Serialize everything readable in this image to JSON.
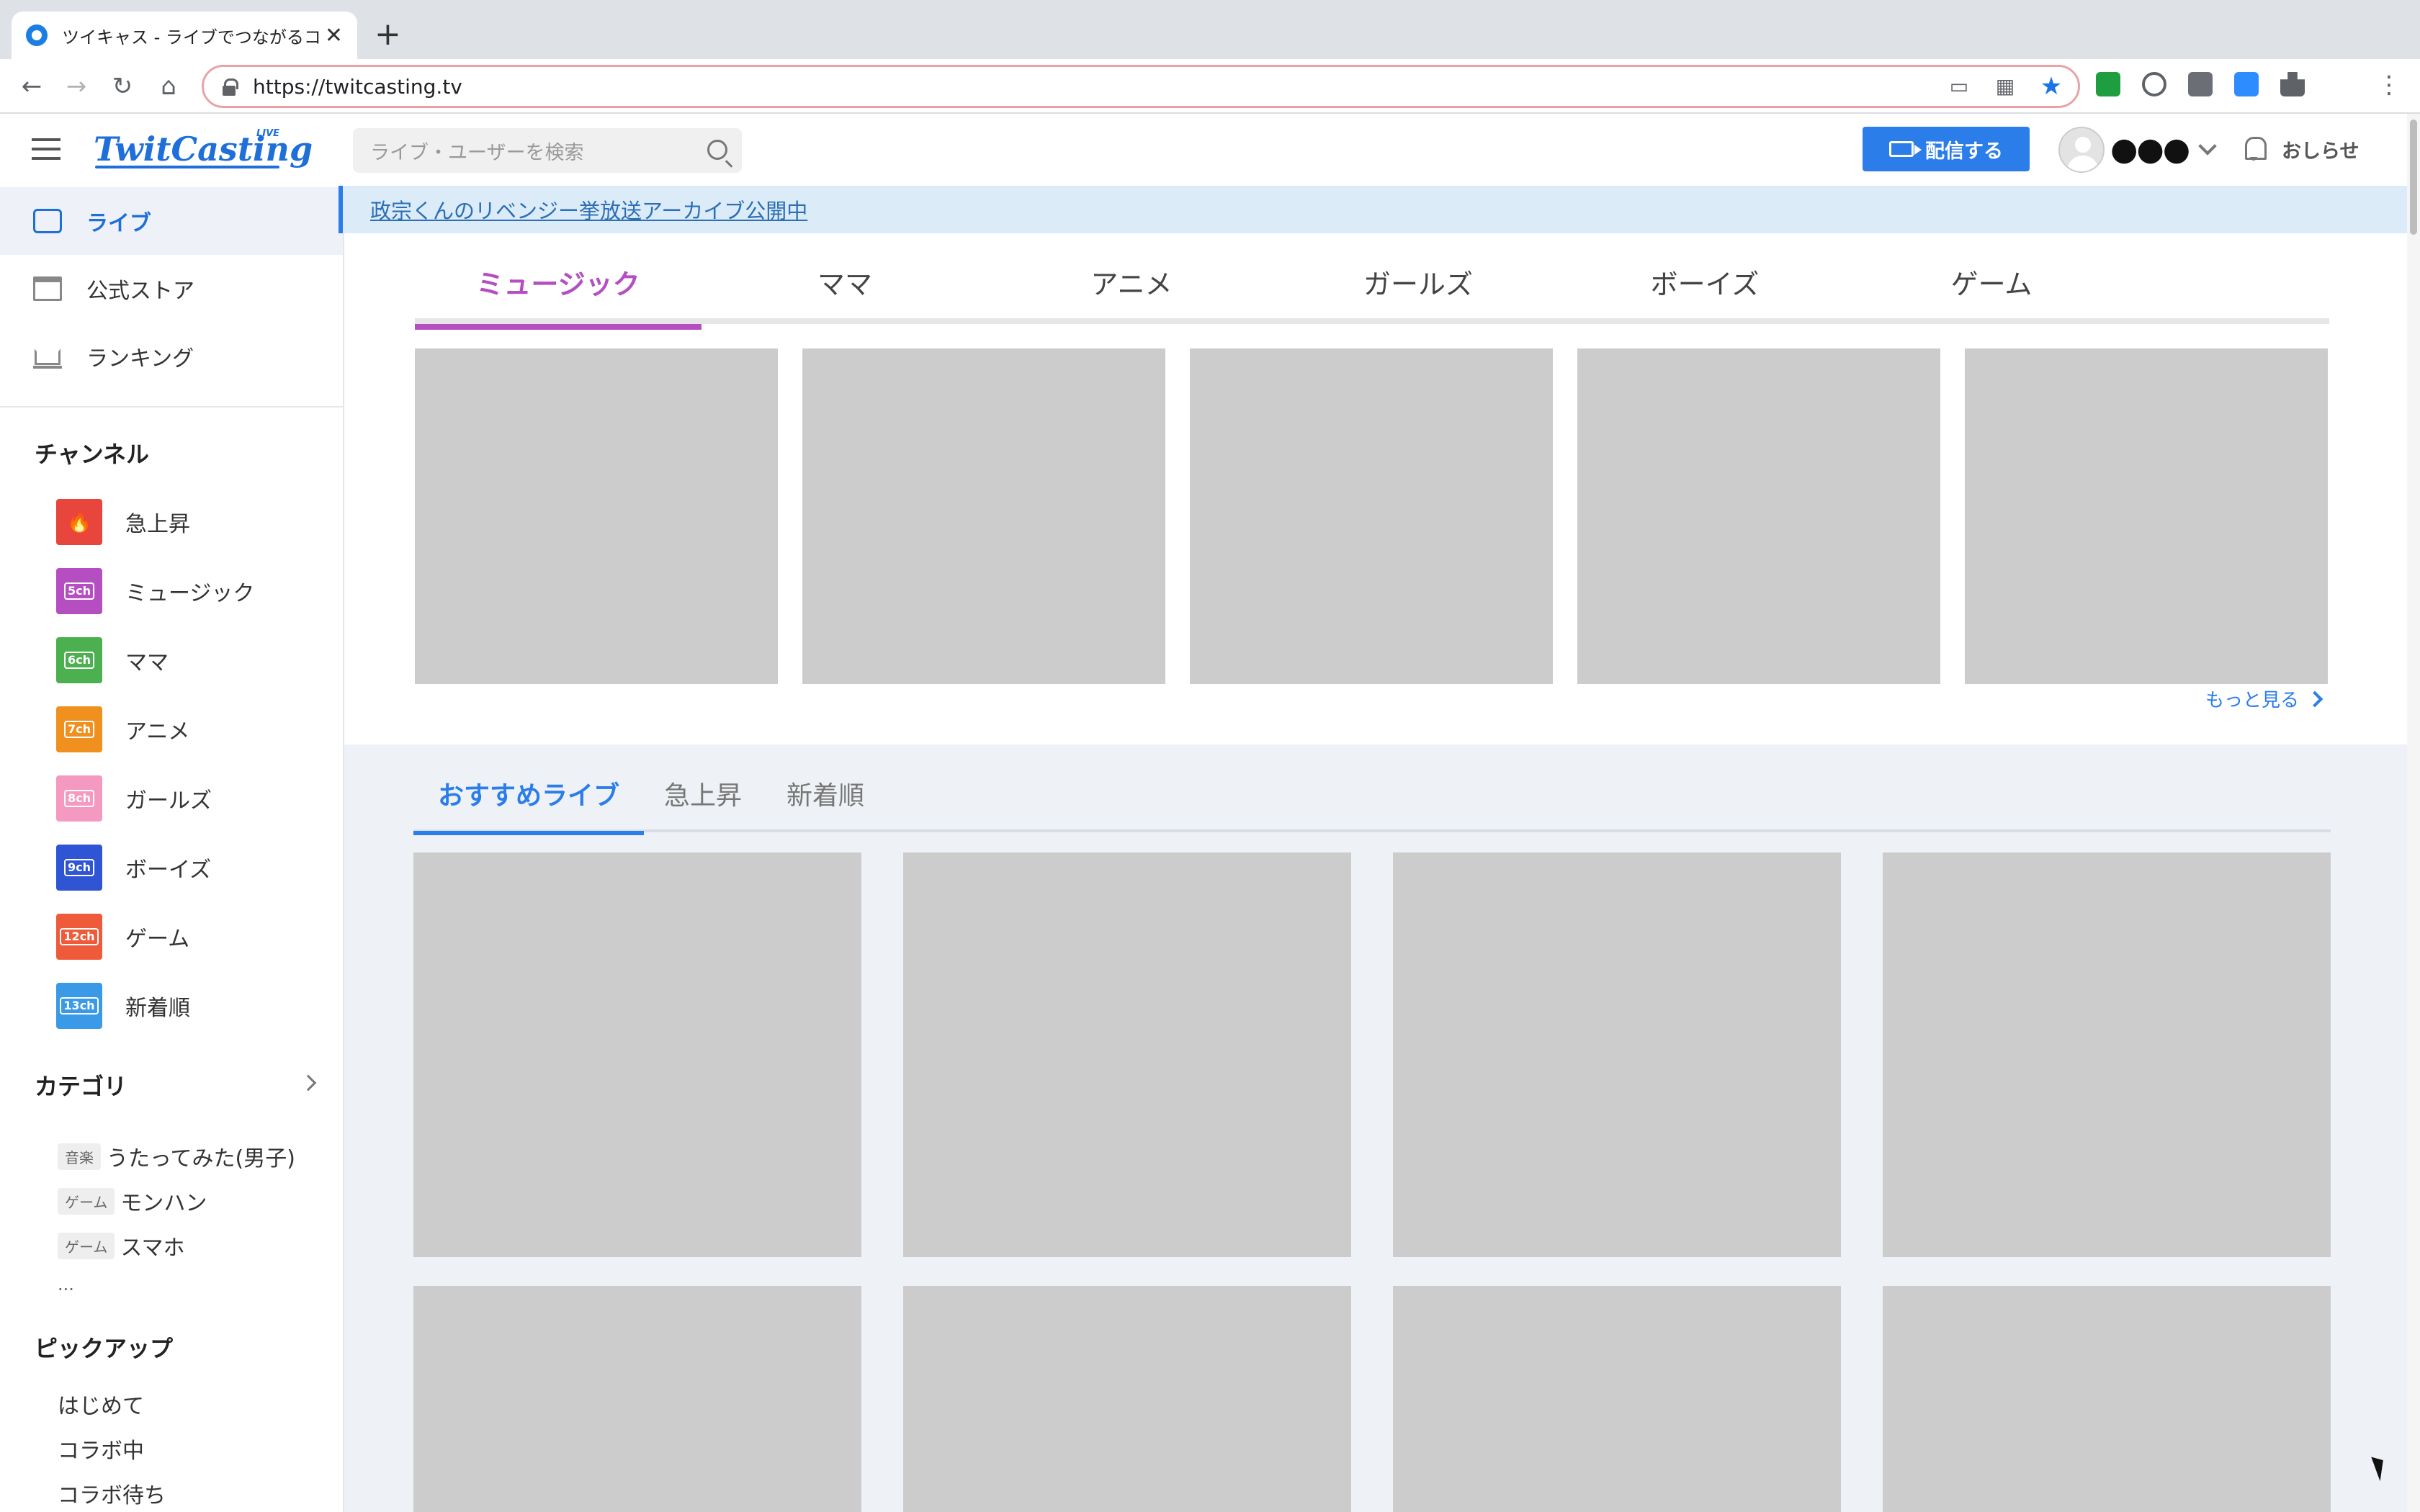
{
  "browser": {
    "tab_title": "ツイキャス - ライブでつながるコミュニティ",
    "tab_close": "✕",
    "new_tab": "+",
    "url": "https://twitcasting.tv",
    "back": "←",
    "forward": "→",
    "reload": "↻",
    "home": "⌂",
    "menu": "⋮",
    "colors": {
      "accent": "#1a73e8",
      "omnibox_border": "#e9a3a8"
    }
  },
  "header": {
    "logo": "TwitCasting",
    "logo_badge": "LIVE",
    "search_placeholder": "ライブ・ユーザーを検索",
    "broadcast_label": "配信する",
    "username": "●●●",
    "notifications_label": "おしらせ",
    "colors": {
      "brand": "#1e6fd9",
      "broadcast_button": "#2b7de9"
    }
  },
  "sidebar": {
    "nav": [
      {
        "label": "ライブ",
        "icon": "tv-icon",
        "active": true
      },
      {
        "label": "公式ストア",
        "icon": "store-icon",
        "active": false
      },
      {
        "label": "ランキング",
        "icon": "crown-icon",
        "active": false
      }
    ],
    "channels_title": "チャンネル",
    "channels": [
      {
        "label": "急上昇",
        "badge": "🔥",
        "color": "#e8453c"
      },
      {
        "label": "ミュージック",
        "badge": "5ch",
        "color": "#b54fc1"
      },
      {
        "label": "ママ",
        "badge": "6ch",
        "color": "#4caf50"
      },
      {
        "label": "アニメ",
        "badge": "7ch",
        "color": "#f0901e"
      },
      {
        "label": "ガールズ",
        "badge": "8ch",
        "color": "#f49ac1"
      },
      {
        "label": "ボーイズ",
        "badge": "9ch",
        "color": "#2f55d4"
      },
      {
        "label": "ゲーム",
        "badge": "12ch",
        "color": "#ef5b3a"
      },
      {
        "label": "新着順",
        "badge": "13ch",
        "color": "#3a9ae8"
      }
    ],
    "categories_title": "カテゴリ",
    "categories": [
      {
        "badge": "音楽",
        "label": "うたってみた(男子)"
      },
      {
        "badge": "ゲーム",
        "label": "モンハン"
      },
      {
        "badge": "ゲーム",
        "label": "スマホ"
      }
    ],
    "categories_more": "...",
    "pickup_title": "ピックアップ",
    "pickup": [
      "はじめて",
      "コラボ中",
      "コラボ待ち"
    ]
  },
  "main": {
    "announcement": "政宗くんのリベンジー挙放送アーカイブ公開中",
    "genre_tabs": [
      "ミュージック",
      "ママ",
      "アニメ",
      "ガールズ",
      "ボーイズ",
      "ゲーム"
    ],
    "genre_active_color": "#b54fc1",
    "more_label": "もっと見る",
    "recommend_tabs": [
      "おすすめライブ",
      "急上昇",
      "新着順"
    ]
  }
}
